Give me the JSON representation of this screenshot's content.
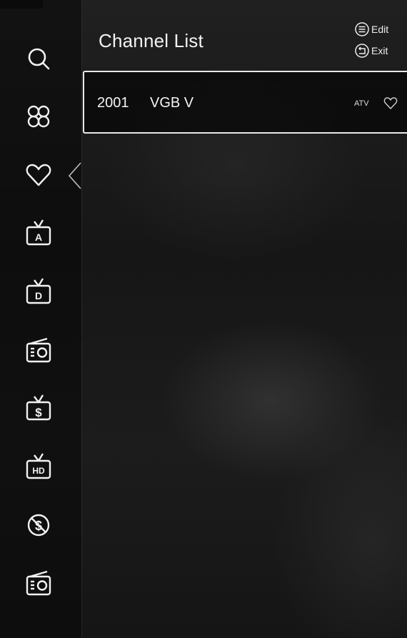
{
  "header": {
    "title": "Channel List",
    "edit_label": "Edit",
    "exit_label": "Exit"
  },
  "sidebar": {
    "items": [
      {
        "icon": "search-icon"
      },
      {
        "icon": "all-channels-icon"
      },
      {
        "icon": "favorite-heart-icon",
        "selected": true
      },
      {
        "icon": "analog-tv-icon",
        "glyph": "A"
      },
      {
        "icon": "digital-tv-icon",
        "glyph": "D"
      },
      {
        "icon": "radio-icon"
      },
      {
        "icon": "pay-tv-icon",
        "glyph": "$"
      },
      {
        "icon": "hd-tv-icon",
        "glyph": "HD"
      },
      {
        "icon": "free-channel-icon",
        "glyph": "$"
      },
      {
        "icon": "radio-icon"
      }
    ]
  },
  "channels": [
    {
      "number": "2001",
      "name": "VGB V",
      "type": "ATV",
      "favorite_icon": "heart-outline-icon"
    }
  ],
  "colors": {
    "text": "#f2f2f2",
    "highlight_border": "#e8e8e8",
    "sidebar_bg": "#0b0b0b"
  }
}
